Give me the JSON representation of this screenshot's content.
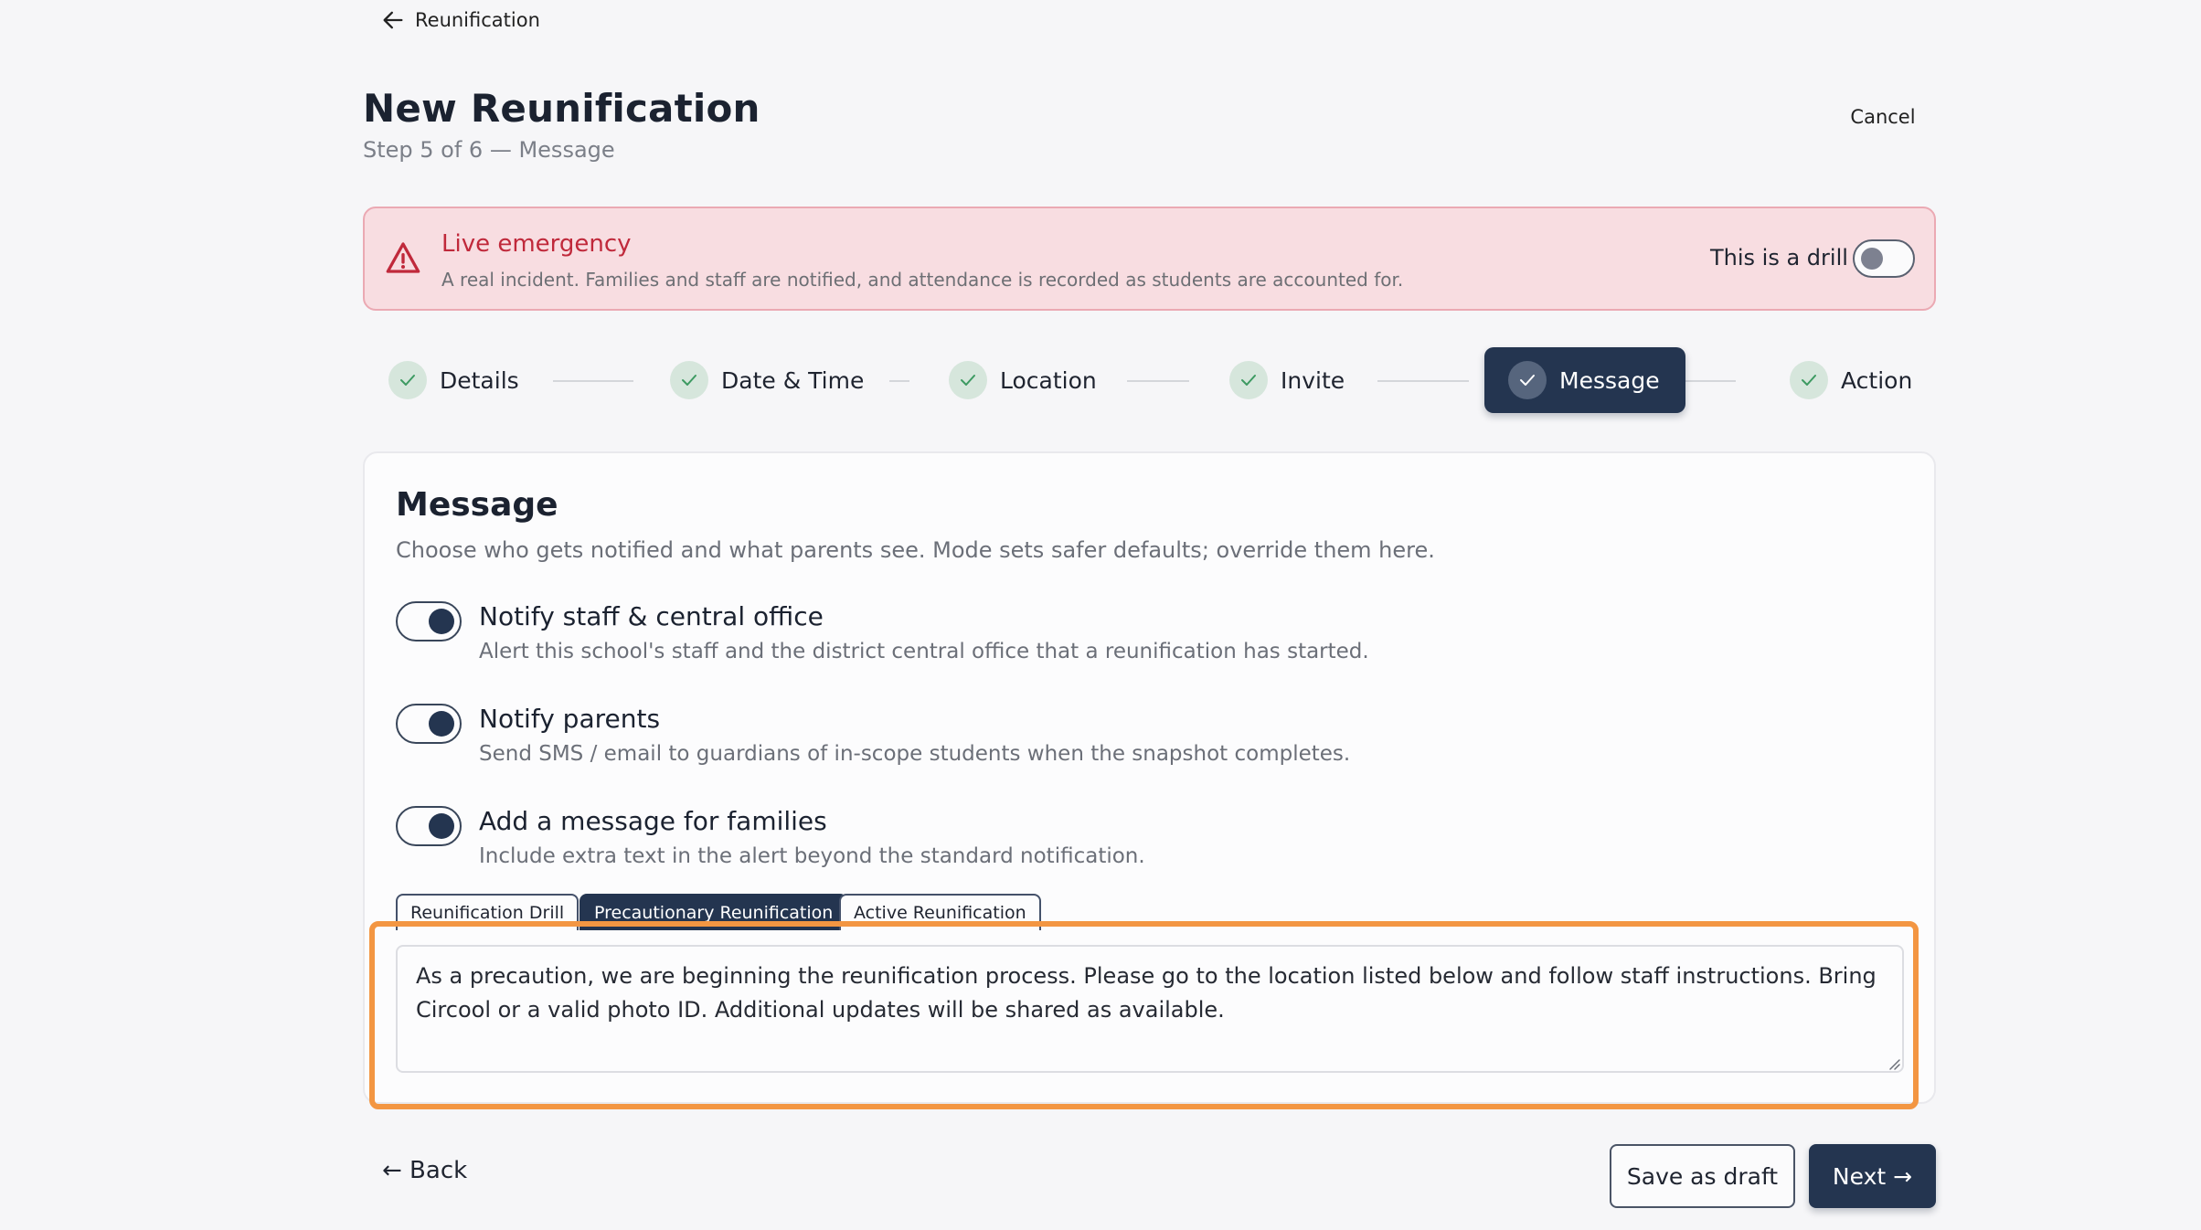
{
  "nav": {
    "back_label": "Reunification"
  },
  "header": {
    "title": "New Reunification",
    "step_label": "Step 5 of 6 — Message",
    "cancel_label": "Cancel"
  },
  "banner": {
    "title": "Live emergency",
    "description": "A real incident. Families and staff are notified, and attendance is recorded as students are accounted for.",
    "drill_label": "This is a drill",
    "drill_enabled": false,
    "accent_color": "#c0293b"
  },
  "steps": [
    {
      "label": "Details",
      "completed": true,
      "active": false
    },
    {
      "label": "Date & Time",
      "completed": true,
      "active": false
    },
    {
      "label": "Location",
      "completed": true,
      "active": false
    },
    {
      "label": "Invite",
      "completed": true,
      "active": false
    },
    {
      "label": "Message",
      "completed": true,
      "active": true
    },
    {
      "label": "Action",
      "completed": true,
      "active": false
    }
  ],
  "message": {
    "title": "Message",
    "subtitle": "Choose who gets notified and what parents see. Mode sets safer defaults; override them here.",
    "options": [
      {
        "title": "Notify staff & central office",
        "description": "Alert this school's staff and the district central office that a reunification has started.",
        "enabled": true
      },
      {
        "title": "Notify parents",
        "description": "Send SMS / email to guardians of in-scope students when the snapshot completes.",
        "enabled": true
      },
      {
        "title": "Add a message for families",
        "description": "Include extra text in the alert beyond the standard notification.",
        "enabled": true
      }
    ],
    "modes": [
      {
        "label": "Reunification Drill",
        "active": false
      },
      {
        "label": "Precautionary Reunification",
        "active": true
      },
      {
        "label": "Active Reunification",
        "active": false
      }
    ],
    "family_message": "As a precaution, we are beginning the reunification process. Please go to the location listed below and follow staff instructions. Bring Circool or a valid photo ID. Additional updates will be shared as available."
  },
  "footer": {
    "back_label": "← Back",
    "save_draft_label": "Save as draft",
    "next_label": "Next →"
  },
  "colors": {
    "primary": "#243550",
    "highlight": "#f39642",
    "check_bg": "#d6e6dc"
  }
}
